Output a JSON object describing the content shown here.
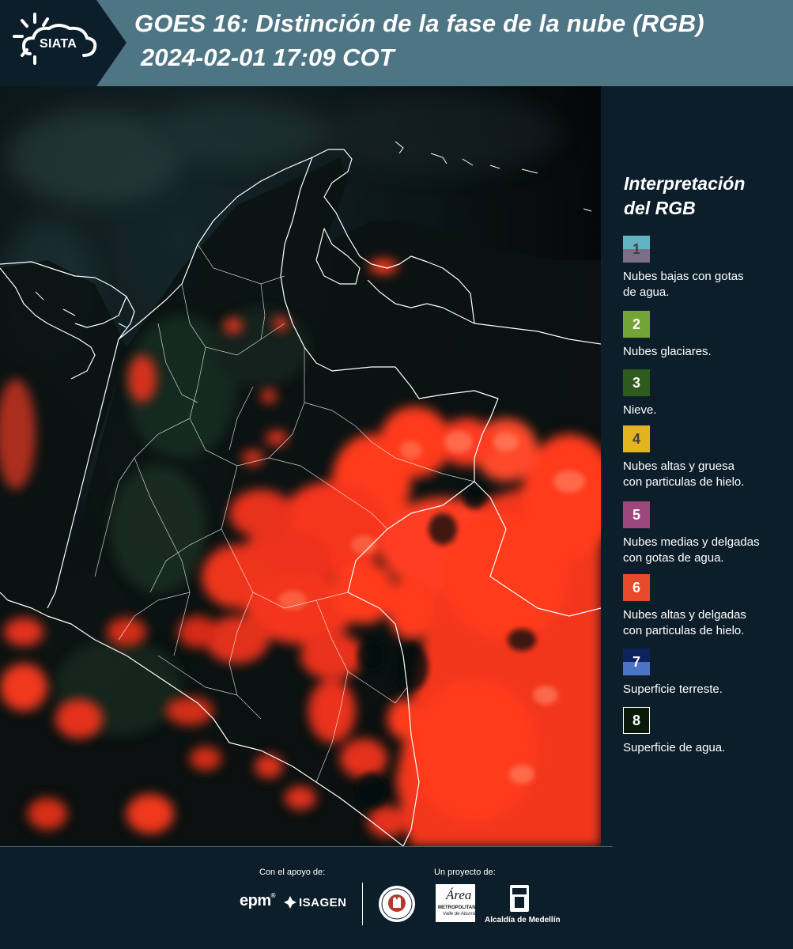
{
  "header": {
    "logo_text": "SIATA",
    "title_line1": "GOES 16: Distinción de la fase de la nube (RGB)",
    "title_line2": "2024-02-01 17:09 COT"
  },
  "legend": {
    "title_line1": "Interpretación",
    "title_line2": "del RGB",
    "items": [
      {
        "number": "1",
        "label_line1": "Nubes bajas con gotas",
        "label_line2": "de agua.",
        "color_top": "#62b4c2",
        "color_bottom": "#7d6e87",
        "num_color": "#3f3f3f"
      },
      {
        "number": "2",
        "label_line1": "Nubes glaciares.",
        "label_line2": "",
        "color_top": "#73a534",
        "color_bottom": "#73a534",
        "num_color": "#ffffff"
      },
      {
        "number": "3",
        "label_line1": "Nieve.",
        "label_line2": "",
        "color_top": "#2e5a1e",
        "color_bottom": "#2e5a1e",
        "num_color": "#ffffff"
      },
      {
        "number": "4",
        "label_line1": "Nubes altas y gruesa",
        "label_line2": "con particulas de hielo.",
        "color_top": "#e2b41f",
        "color_bottom": "#e2b41f",
        "num_color": "#3f3f3f"
      },
      {
        "number": "5",
        "label_line1": "Nubes medias y delgadas",
        "label_line2": "con gotas de agua.",
        "color_top": "#9b477c",
        "color_bottom": "#9b477c",
        "num_color": "#ffffff"
      },
      {
        "number": "6",
        "label_line1": "Nubes altas y delgadas",
        "label_line2": "con particulas de hielo.",
        "color_top": "#e64a2b",
        "color_bottom": "#e64a2b",
        "num_color": "#ffffff"
      },
      {
        "number": "7",
        "label_line1": "Superficie terreste.",
        "label_line2": "",
        "color_top": "#0e225e",
        "color_bottom": "#4c73c4",
        "num_color": "#ffffff"
      },
      {
        "number": "8",
        "label_line1": "Superficie de agua.",
        "label_line2": "",
        "color_top": "#0a1a0a",
        "color_bottom": "#0a1a0a",
        "num_color": "#ffffff"
      }
    ]
  },
  "footer": {
    "support_label": "Con el apoyo de:",
    "project_label": "Un proyecto de:",
    "sponsor1": "epm",
    "sponsor2": "ISAGEN",
    "amva_name": "Área",
    "amva_sub1": "METROPOLITANA",
    "amva_sub2": "Valle de Aburrá",
    "alcaldia": "Alcaldía de Medellín"
  },
  "colors": {
    "background": "#0d1e2b",
    "title_band": "#4e7584",
    "ice_cloud_red": "#ff3b22"
  }
}
